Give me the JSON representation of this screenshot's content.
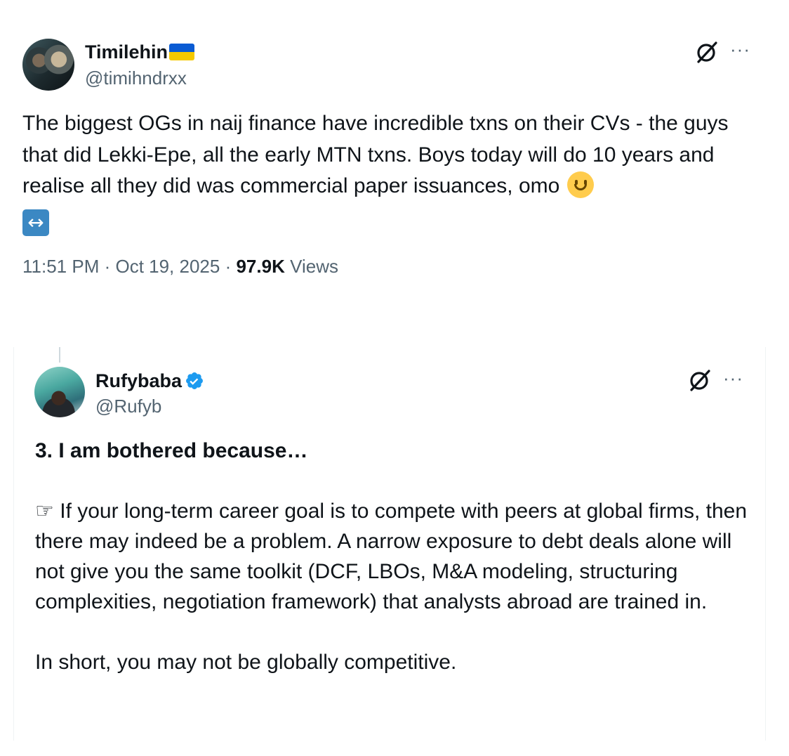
{
  "tweet": {
    "display_name": "Timilehin",
    "flag_icon": "ukraine-flag-icon",
    "handle": "@timihndrxx",
    "text": "The biggest OGs in naij finance have incredible txns on their CVs - the guys that did Lekki-Epe, all the early MTN txns. Boys today will do 10 years and realise all they did was commercial paper issuances, omo",
    "emojis": [
      "slightly-smiling-face",
      "left-right-arrow"
    ],
    "time": "11:51 PM",
    "date": "Oct 19, 2025",
    "views_count": "97.9K",
    "views_label": "Views"
  },
  "quoted": {
    "display_name": "Rufybaba",
    "verified_icon": "verified-badge-icon",
    "handle": "@Rufyb",
    "heading": "3. I am bothered because…",
    "paragraph1": "☞ If your long-term career goal is to compete with peers at global firms, then there may indeed be a problem. A narrow exposure to debt deals alone will not give you the same toolkit (DCF, LBOs, M&A modeling, structuring complexities, negotiation framework) that analysts abroad are trained in.",
    "paragraph2": "In short, you may not be globally competitive."
  },
  "icons": {
    "grok": "grok-icon",
    "more": "more-options-icon",
    "more_glyph": "···"
  },
  "colors": {
    "text": "#0f1419",
    "secondary": "#536471",
    "verified": "#1d9bf0"
  }
}
